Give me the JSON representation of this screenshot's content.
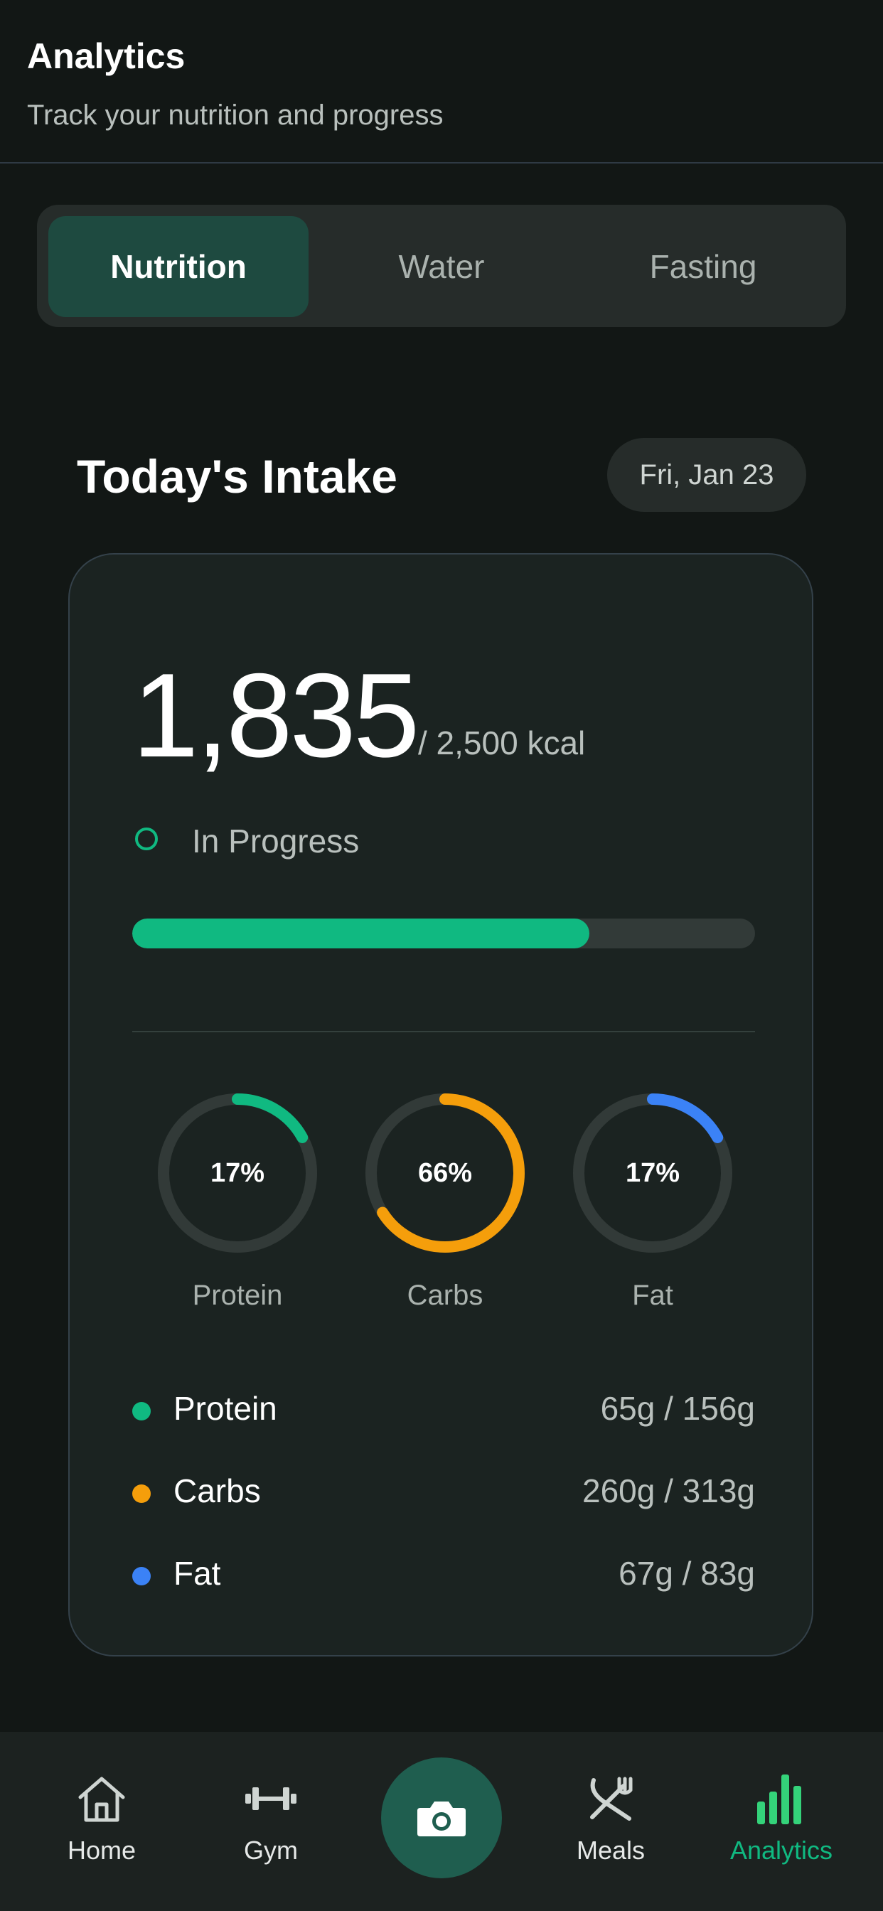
{
  "header": {
    "title": "Analytics",
    "subtitle": "Track your nutrition and progress"
  },
  "tabs": [
    {
      "label": "Nutrition",
      "active": true
    },
    {
      "label": "Water",
      "active": false
    },
    {
      "label": "Fasting",
      "active": false
    }
  ],
  "section": {
    "title": "Today's Intake",
    "date": "Fri, Jan 23"
  },
  "calories": {
    "value": "1,835",
    "goal": "/ 2,500 kcal",
    "status": "In Progress",
    "progress": 0.734
  },
  "macros": [
    {
      "name": "Protein",
      "percent": "17%",
      "fraction": 0.17,
      "color": "#10b981",
      "amount": "65g / 156g"
    },
    {
      "name": "Carbs",
      "percent": "66%",
      "fraction": 0.66,
      "color": "#f59e0b",
      "amount": "260g / 313g"
    },
    {
      "name": "Fat",
      "percent": "17%",
      "fraction": 0.17,
      "color": "#3b82f6",
      "amount": "67g / 83g"
    }
  ],
  "nav": [
    {
      "label": "Home",
      "icon": "home-icon"
    },
    {
      "label": "Gym",
      "icon": "dumbbell-icon"
    },
    {
      "label": "",
      "icon": "camera-icon"
    },
    {
      "label": "Meals",
      "icon": "utensils-icon"
    },
    {
      "label": "Analytics",
      "icon": "bar-chart-icon",
      "active": true
    }
  ],
  "colors": {
    "accent": "#10b981",
    "track": "#323a38"
  }
}
